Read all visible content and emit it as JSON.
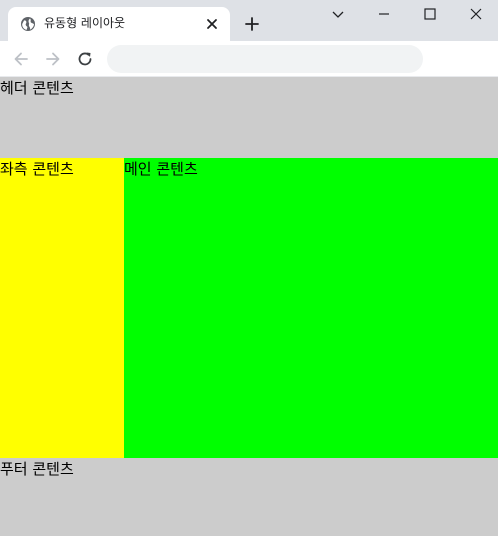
{
  "browser": {
    "tab": {
      "title": "유동형 레이아웃",
      "favicon": "globe-icon"
    },
    "new_tab_icon": "plus-icon",
    "window_controls": [
      "chevron-down-icon",
      "minimize-icon",
      "maximize-icon",
      "close-icon"
    ],
    "nav_icons": [
      "back-arrow-icon",
      "forward-arrow-icon",
      "reload-icon"
    ],
    "address_bar": {
      "value": "",
      "placeholder": ""
    }
  },
  "page": {
    "header": {
      "text": "헤더 콘텐츠",
      "background": "#cccccc"
    },
    "sidebar": {
      "text": "좌측 콘텐츠",
      "background": "#ffff00"
    },
    "main": {
      "text": "메인 콘텐츠",
      "background": "#00ff00"
    },
    "footer": {
      "text": "푸터 콘텐츠",
      "background": "#cccccc"
    }
  }
}
